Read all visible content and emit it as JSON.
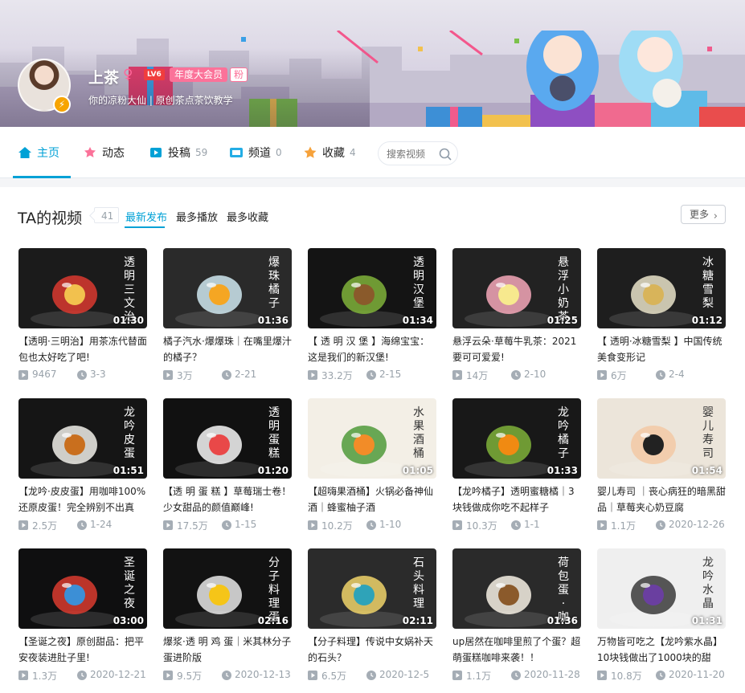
{
  "user": {
    "name": "上茶",
    "level": "LV6",
    "vip": "年度大会员",
    "fan_badge": "粉",
    "sign": "你的凉粉大仙 | 原创茶点茶饮教学"
  },
  "nav": {
    "items": [
      {
        "label": "主页",
        "count": ""
      },
      {
        "label": "动态",
        "count": ""
      },
      {
        "label": "投稿",
        "count": "59"
      },
      {
        "label": "频道",
        "count": "0"
      },
      {
        "label": "收藏",
        "count": "4"
      }
    ],
    "search_placeholder": "搜索视频"
  },
  "section": {
    "title": "TA的视频",
    "count": "41",
    "sort_tabs": [
      "最新发布",
      "最多播放",
      "最多收藏"
    ],
    "more_label": "更多"
  },
  "videos": [
    {
      "title": "【透明·三明治】用茶冻代替面包也太好吃了吧!",
      "plays": "9467",
      "date": "3-3",
      "duration": "01:30",
      "overlay": "透明三文治",
      "colors": [
        "#1b1b1b",
        "#f2c14e",
        "#d9382f"
      ]
    },
    {
      "title": "橘子汽水·爆爆珠｜在嘴里爆汁的橘子？",
      "plays": "3万",
      "date": "2-21",
      "duration": "01:36",
      "overlay": "爆珠橘子",
      "colors": [
        "#2a2a2a",
        "#f5a623",
        "#cfe8f0"
      ]
    },
    {
      "title": "【 透 明 汉 堡 】海绵宝宝：这是我们的新汉堡!",
      "plays": "33.2万",
      "date": "2-15",
      "duration": "01:34",
      "overlay": "透明汉堡",
      "colors": [
        "#141414",
        "#8a5a2b",
        "#7fb23a"
      ]
    },
    {
      "title": "悬浮云朵·草莓牛乳茶：2021要可可爱爱!",
      "plays": "14万",
      "date": "2-10",
      "duration": "01:25",
      "overlay": "悬浮小奶茶",
      "colors": [
        "#222222",
        "#f7e98e",
        "#f4a7b9"
      ]
    },
    {
      "title": "【 透明·冰糖雪梨 】中国传统美食变形记",
      "plays": "6万",
      "date": "2-4",
      "duration": "01:12",
      "overlay": "冰糖雪梨",
      "colors": [
        "#1e1e1e",
        "#d8b45a",
        "#e9e3c9"
      ]
    },
    {
      "title": "【龙吟·皮皮蛋】用咖啡100%还原皮蛋！完全辨别不出真",
      "plays": "2.5万",
      "date": "1-24",
      "duration": "01:51",
      "overlay": "龙吟皮蛋",
      "colors": [
        "#151515",
        "#c96f1e",
        "#f0efe9"
      ]
    },
    {
      "title": "【透 明 蛋 糕 】草莓瑞士卷！少女甜品的颜值巅峰!",
      "plays": "17.5万",
      "date": "1-15",
      "duration": "01:20",
      "overlay": "透明蛋糕",
      "colors": [
        "#111111",
        "#e94848",
        "#f7f7f7"
      ]
    },
    {
      "title": "【超嗨果酒桶】火锅必备神仙酒｜蜂蜜柚子酒",
      "plays": "10.2万",
      "date": "1-10",
      "duration": "01:05",
      "overlay": "水果酒桶",
      "colors": [
        "#f3efe6",
        "#f28c28",
        "#4f9a3a"
      ]
    },
    {
      "title": "【龙吟橘子】透明蜜糖橘｜3块钱做成你吃不起样子",
      "plays": "10.3万",
      "date": "1-1",
      "duration": "01:33",
      "overlay": "龙吟橘子",
      "colors": [
        "#181818",
        "#f08a12",
        "#7fb23a"
      ]
    },
    {
      "title": "婴儿寿司 ｜丧心病狂的暗黑甜品｜草莓夹心奶豆腐",
      "plays": "1.1万",
      "date": "2020-12-26",
      "duration": "01:54",
      "overlay": "婴儿寿司",
      "colors": [
        "#ece5da",
        "#222222",
        "#f3c9a5"
      ]
    },
    {
      "title": "【圣诞之夜】原创甜品：把平安夜装进肚子里!",
      "plays": "1.3万",
      "date": "2020-12-21",
      "duration": "03:00",
      "overlay": "圣诞之夜",
      "colors": [
        "#0f0f10",
        "#3c8fd6",
        "#d93b2f"
      ]
    },
    {
      "title": "爆浆·透 明 鸡 蛋｜米其林分子蛋进阶版",
      "plays": "9.5万",
      "date": "2020-12-13",
      "duration": "02:16",
      "overlay": "分子料理 蛋",
      "colors": [
        "#121212",
        "#f5c518",
        "#e8e8e8"
      ]
    },
    {
      "title": "【分子料理】传说中女娲补天的石头？",
      "plays": "6.5万",
      "date": "2020-12-5",
      "duration": "02:11",
      "overlay": "石头料理",
      "colors": [
        "#2b2b2b",
        "#2fa3b8",
        "#f0d36a"
      ]
    },
    {
      "title": "up居然在咖啡里煎了个蛋？超萌蛋糕咖啡来袭！！",
      "plays": "1.1万",
      "date": "2020-11-28",
      "duration": "01:36",
      "overlay": "荷包蛋·咖啡",
      "colors": [
        "#2a2a2a",
        "#8b5a2b",
        "#f6f0e4"
      ]
    },
    {
      "title": "万物皆可吃之【龙吟紫水晶】10块钱做出了1000块的甜",
      "plays": "10.8万",
      "date": "2020-11-20",
      "duration": "01:31",
      "overlay": "龙吟水晶",
      "colors": [
        "#efefef",
        "#6a3fa0",
        "#3a3a3a"
      ]
    }
  ]
}
